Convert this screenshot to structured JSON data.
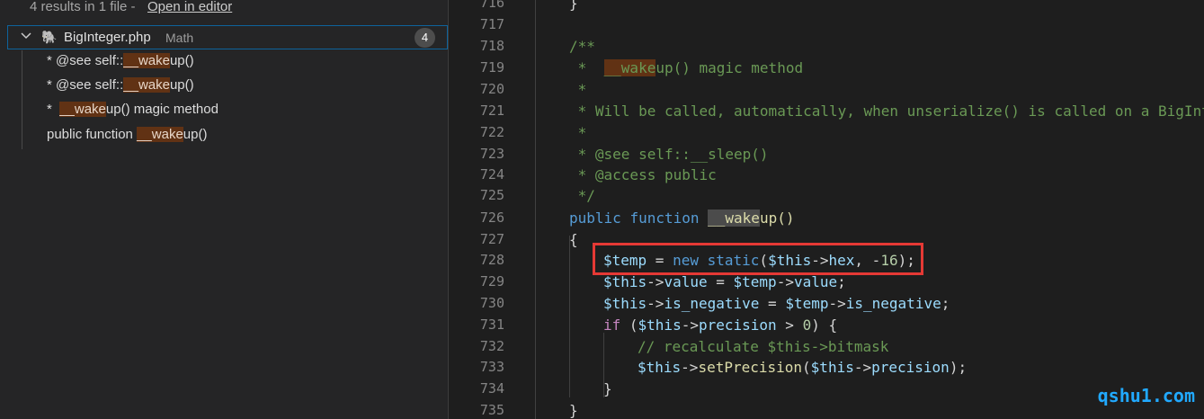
{
  "search": {
    "summary": "4 results in 1 file - ",
    "open_in_editor": "Open in editor",
    "file": {
      "name": "BigInteger.php",
      "dir": "Math",
      "count": "4",
      "icon": "php-elephant-icon"
    },
    "matches": [
      {
        "before": "* @see self::",
        "hit": "__wake",
        "after": "up()"
      },
      {
        "before": "* @see self::",
        "hit": "__wake",
        "after": "up()"
      },
      {
        "before": "*  ",
        "hit": "__wake",
        "after": "up() magic method"
      },
      {
        "before": "public function ",
        "hit": "__wake",
        "after": "up()"
      }
    ]
  },
  "editor": {
    "line_numbers": [
      "716",
      "717",
      "718",
      "719",
      "720",
      "721",
      "722",
      "723",
      "724",
      "725",
      "726",
      "727",
      "728",
      "729",
      "730",
      "731",
      "732",
      "733",
      "734",
      "735"
    ],
    "lines": {
      "l716": "}",
      "l718": "/**",
      "l719_a": " *  ",
      "l719_hit": "__wake",
      "l719_b": "up() magic method",
      "l720": " *",
      "l721": " * Will be called, automatically, when unserialize() is called on a BigInt",
      "l722": " *",
      "l723": " * @see self::__sleep()",
      "l724": " * @access public",
      "l725": " */",
      "l726_kw1": "public",
      "l726_kw2": "function",
      "l726_hit": "__wake",
      "l726_b": "up()",
      "l727": "{",
      "l734": "}",
      "l735": "}"
    }
  },
  "watermark": "qshu1.com"
}
